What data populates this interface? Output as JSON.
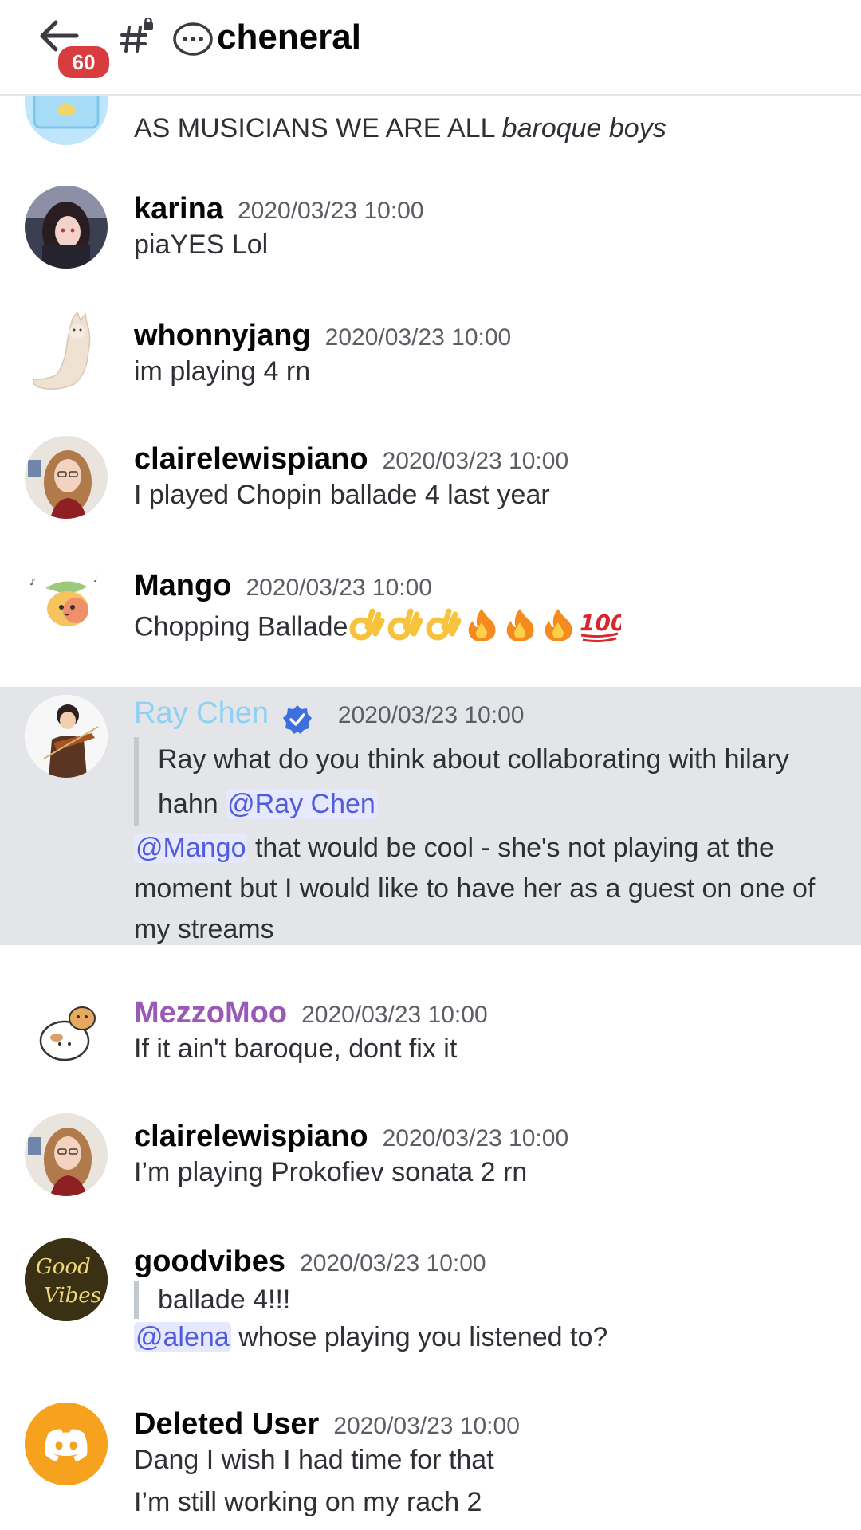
{
  "header": {
    "back_label": "Back",
    "notification_count": "60",
    "channel_name": "cheneral"
  },
  "messages": [
    {
      "text_html": "AS MUSICIANS WE ARE ALL",
      "text_emph": "baroque boys"
    },
    {
      "author": "karina",
      "timestamp": "2020/03/23 10:00",
      "text": "piaYES Lol"
    },
    {
      "author": "whonnyjang",
      "timestamp": "2020/03/23 10:00",
      "text": "im playing 4 rn"
    },
    {
      "author": "clairelewispiano",
      "timestamp": "2020/03/23 10:00",
      "text": "I played Chopin ballade 4 last year"
    },
    {
      "author": "Mango",
      "timestamp": "2020/03/23 10:00",
      "text": "Chopping Ballade",
      "emoji": [
        "ok-hand",
        "ok-hand",
        "ok-hand",
        "fire",
        "fire",
        "fire",
        "hundred-points"
      ]
    },
    {
      "author": "Ray Chen",
      "author_color": "#8fd1f5",
      "verified": true,
      "timestamp": "2020/03/23 10:00",
      "reply_line1": "Ray what do you think about collaborating with hilary",
      "reply_line2": "hahn",
      "reply_mention": "@Ray Chen",
      "mention": "@Mango",
      "text_line1": "that would be cool - she's not playing at the",
      "text_line2": "moment but I would like to have her as a guest on one of",
      "text_line3": "my streams"
    },
    {
      "author": "MezzoMoo",
      "author_color": "#9b59b6",
      "timestamp": "2020/03/23 10:00",
      "text": "If it ain't baroque, dont fix it"
    },
    {
      "author": "clairelewispiano",
      "timestamp": "2020/03/23 10:00",
      "text": "I’m playing Prokofiev sonata 2 rn"
    },
    {
      "author": "goodvibes",
      "timestamp": "2020/03/23 10:00",
      "reply": "ballade 4!!!",
      "mention": "@alena",
      "text": "whose playing you listened to?"
    },
    {
      "author": "Deleted User",
      "timestamp": "2020/03/23 10:00",
      "text": "Dang I wish I had time for that",
      "text2": "I’m still working on my rach 2"
    }
  ],
  "colors": {
    "accent": "#5865f2",
    "badge": "#d83c3e",
    "mention_bg": "#e6e8fd",
    "mention_fg": "#505cdc",
    "highlight": "#e3e5e8"
  }
}
